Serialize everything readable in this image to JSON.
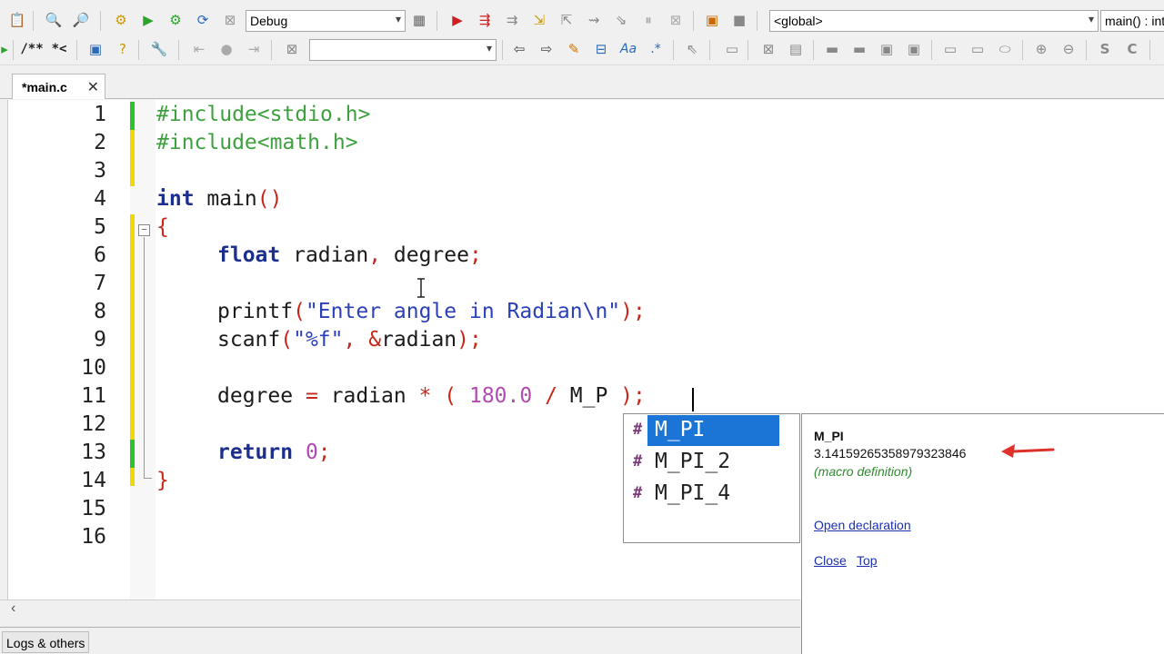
{
  "toolbar1": {
    "build_target": "Debug",
    "scope": "<global>",
    "function": "main() : int"
  },
  "toolbar2": {
    "comment_label": "/**",
    "comment_label2": "*<",
    "search_value": ""
  },
  "tab": {
    "label": "*main.c",
    "close": "✕"
  },
  "editor": {
    "line_numbers": [
      "1",
      "2",
      "3",
      "4",
      "5",
      "6",
      "7",
      "8",
      "9",
      "10",
      "11",
      "12",
      "13",
      "14",
      "15",
      "16"
    ],
    "lines": {
      "l1": "#include<stdio.h>",
      "l2": "#include<math.h>",
      "l4_kw": "int",
      "l4_rest": " main",
      "l4_paren": "()",
      "l5": "{",
      "l6_kw": "float",
      "l6_a": " radian",
      "l6_b": ",",
      "l6_c": " degree",
      "l6_d": ";",
      "l8_fn": "printf",
      "l8_open": "(",
      "l8_str": "\"Enter angle in Radian\\n\"",
      "l8_close": ");",
      "l9_fn": "scanf",
      "l9_open": "(",
      "l9_str": "\"%f\"",
      "l9_comma": ",",
      "l9_amp": " &",
      "l9_var": "radian",
      "l9_close": ");",
      "l11_a": "degree",
      "l11_eq": " = ",
      "l11_b": "radian",
      "l11_mul": " * ",
      "l11_po": "( ",
      "l11_num": "180.0",
      "l11_div": " / ",
      "l11_c": "M_P",
      "l11_pc": " );",
      "l13_kw": "return",
      "l13_num": " 0",
      "l13_semi": ";",
      "l14": "}"
    }
  },
  "autocomplete": {
    "items": [
      {
        "icon": "#",
        "label": "M_PI",
        "selected": true
      },
      {
        "icon": "#",
        "label": "M_PI_2",
        "selected": false
      },
      {
        "icon": "#",
        "label": "M_PI_4",
        "selected": false
      }
    ]
  },
  "doc": {
    "name": "M_PI",
    "value": "3.14159265358979323846",
    "kind": "(macro definition)",
    "open_declaration": "Open declaration",
    "close": "Close",
    "top": "Top"
  },
  "logs": {
    "label": "Logs & others"
  },
  "colors": {
    "preprocessor": "#3fa03f",
    "keyword": "#1c2f8c",
    "string": "#2a3fb8",
    "number": "#b24ab2",
    "operator": "#c8261b",
    "selection": "#1a75d6",
    "arrow": "#e0302a"
  }
}
